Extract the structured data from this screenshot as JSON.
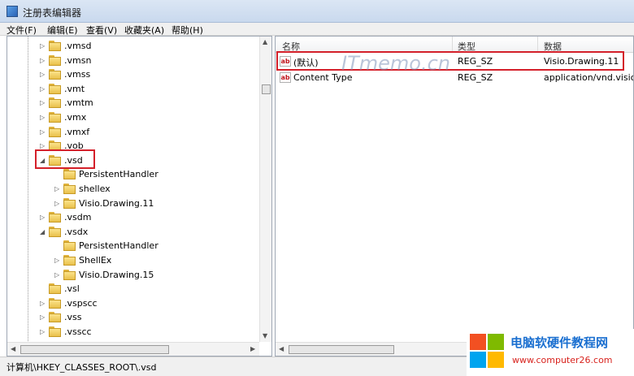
{
  "window": {
    "title": "注册表编辑器"
  },
  "menu": [
    "文件(F)",
    "编辑(E)",
    "查看(V)",
    "收藏夹(A)",
    "帮助(H)"
  ],
  "tree": {
    "items": [
      {
        "label": ".vmsd",
        "level": 1,
        "has_children": true
      },
      {
        "label": ".vmsn",
        "level": 1,
        "has_children": true
      },
      {
        "label": ".vmss",
        "level": 1,
        "has_children": true
      },
      {
        "label": ".vmt",
        "level": 1,
        "has_children": true
      },
      {
        "label": ".vmtm",
        "level": 1,
        "has_children": true
      },
      {
        "label": ".vmx",
        "level": 1,
        "has_children": true
      },
      {
        "label": ".vmxf",
        "level": 1,
        "has_children": true
      },
      {
        "label": ".vob",
        "level": 1,
        "has_children": true
      },
      {
        "label": ".vsd",
        "level": 1,
        "has_children": true,
        "expanded": true,
        "selected": true
      },
      {
        "label": "PersistentHandler",
        "level": 2,
        "has_children": false
      },
      {
        "label": "shellex",
        "level": 2,
        "has_children": true
      },
      {
        "label": "Visio.Drawing.11",
        "level": 2,
        "has_children": true
      },
      {
        "label": ".vsdm",
        "level": 1,
        "has_children": true
      },
      {
        "label": ".vsdx",
        "level": 1,
        "has_children": true,
        "expanded": true
      },
      {
        "label": "PersistentHandler",
        "level": 2,
        "has_children": false
      },
      {
        "label": "ShellEx",
        "level": 2,
        "has_children": true
      },
      {
        "label": "Visio.Drawing.15",
        "level": 2,
        "has_children": true
      },
      {
        "label": ".vsl",
        "level": 1,
        "has_children": false
      },
      {
        "label": ".vspscc",
        "level": 1,
        "has_children": true
      },
      {
        "label": ".vss",
        "level": 1,
        "has_children": true
      },
      {
        "label": ".vsscc",
        "level": 1,
        "has_children": true
      }
    ]
  },
  "list": {
    "columns": [
      "名称",
      "类型",
      "数据"
    ],
    "rows": [
      {
        "name": "(默认)",
        "type": "REG_SZ",
        "data": "Visio.Drawing.11",
        "highlighted": true
      },
      {
        "name": "Content Type",
        "type": "REG_SZ",
        "data": "application/vnd.visio"
      }
    ]
  },
  "watermark": "ITmemo.cn",
  "status": {
    "path": "计算机\\HKEY_CLASSES_ROOT\\.vsd"
  },
  "logo": {
    "brand": "电脑软硬件教程网",
    "url": "www.computer26.com",
    "colors": [
      "#f25022",
      "#7fba00",
      "#00a4ef",
      "#ffb900"
    ]
  },
  "colors": {
    "highlight_border": "#d4202a",
    "folder": "#e9c04b"
  }
}
